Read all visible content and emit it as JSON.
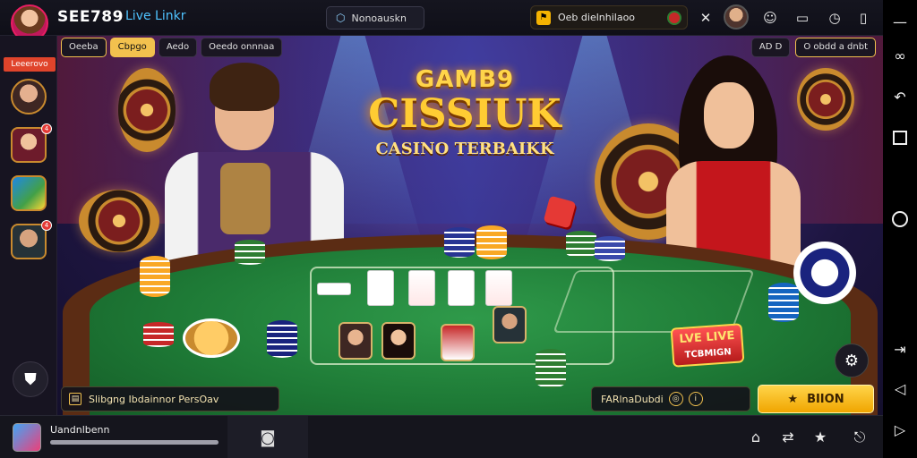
{
  "topbar": {
    "brand": "SEE789",
    "live_link": "Live Linkr",
    "search_text": "Nonoauskn",
    "notification_text": "Oeb dielnhilaoo",
    "icons": [
      "tools-icon",
      "user-avatar",
      "smile-icon",
      "screen-icon",
      "clock-icon",
      "bookmark-icon"
    ]
  },
  "left_rail": {
    "badge": "Leeerovo",
    "rail_avatars": [
      "dealer-1",
      "dealer-2",
      "dealer-3",
      "dealer-4"
    ],
    "dot_labels": [
      "",
      "4",
      "",
      "4"
    ]
  },
  "overlay": {
    "tabs": [
      "Oeeba",
      "Cbpgo",
      "Aedo",
      "Oeedo onnnaa"
    ],
    "active_tab": 1,
    "right_tabs": [
      "AD D",
      "O obdd a dnbt"
    ]
  },
  "title": {
    "line1": "GAMB9",
    "line2": "CISSIUK",
    "line3": "CASINO TERBAIKK"
  },
  "live_sign": {
    "line1": "LVE LIVE",
    "line2": "TCBMIGN"
  },
  "bottom": {
    "bet_info": "Slibgng Ibdainnor PersOav",
    "balance": "FARlnaDubdi",
    "bet_button": "BIION",
    "bet_button_icon": "star-icon"
  },
  "statusbar": {
    "username": "Uandnlbenn",
    "progress": 1.0,
    "icons": [
      "home-icon",
      "shuffle-icon",
      "star-icon",
      "exit-icon"
    ]
  },
  "nav_rail": {
    "buttons": [
      "minimize-icon",
      "link-icon",
      "back-icon",
      "square-icon",
      "circle-icon",
      "forward-icon",
      "back-arrow-icon",
      "forward-arrow-icon"
    ]
  },
  "colors": {
    "accent_gold": "#f2c14e",
    "felt_green": "#1e7a36",
    "table_wood": "#5b2c14",
    "live_link_blue": "#4fc3ff",
    "rail_badge_red": "#e0442b"
  }
}
